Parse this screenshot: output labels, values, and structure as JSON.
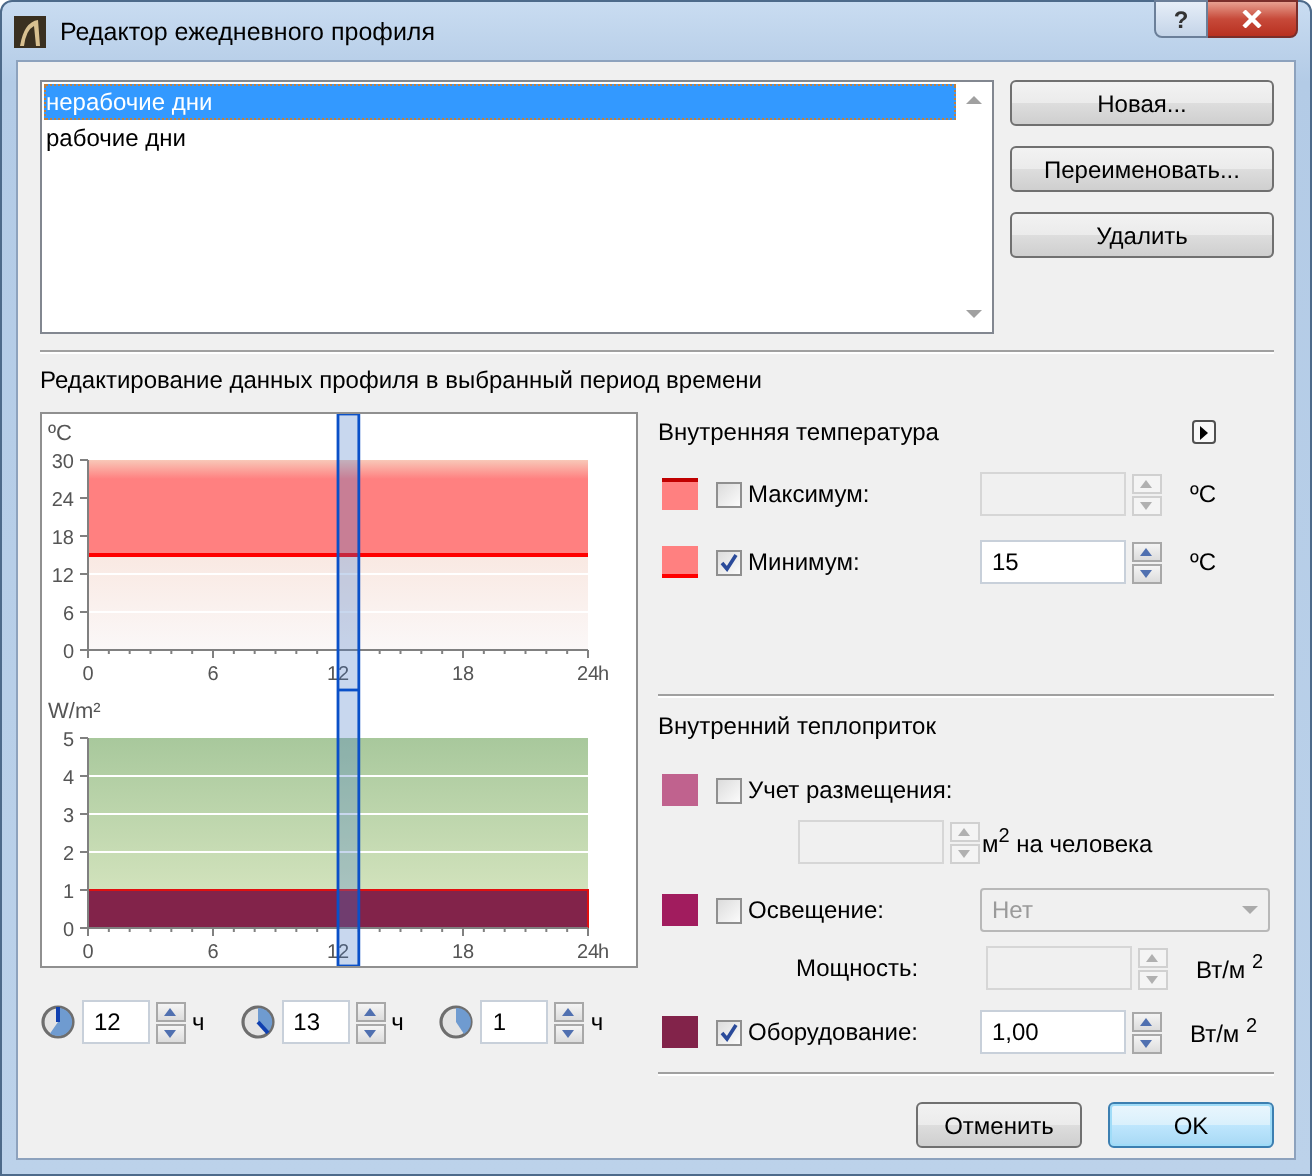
{
  "window": {
    "title": "Редактор ежедневного профиля",
    "help_button": "?"
  },
  "profiles": {
    "items": [
      {
        "label": "нерабочие дни",
        "selected": true
      },
      {
        "label": "рабочие дни",
        "selected": false
      }
    ]
  },
  "profile_buttons": [
    "Новая...",
    "Переименовать...",
    "Удалить"
  ],
  "period_section": {
    "title": "Редактирование данных профиля в выбранный период времени"
  },
  "temperature_chart": {
    "chart_data": {
      "type": "line",
      "ylabel": "ºC",
      "xlabel": "h",
      "x": [
        0,
        24
      ],
      "series": [
        {
          "color": "#ff0000",
          "values": [
            15,
            15
          ]
        }
      ],
      "xlim": [
        0,
        24
      ],
      "ylim": [
        0,
        30
      ],
      "xticks": [
        0,
        6,
        12,
        18,
        24
      ],
      "yticks": [
        0,
        6,
        12,
        18,
        24,
        30
      ],
      "grid": true,
      "bands": [
        {
          "axis": "x",
          "from": 12,
          "to": 13
        }
      ]
    }
  },
  "heat_chart": {
    "chart_data": {
      "type": "area",
      "ylabel": "W/m²",
      "xlabel": "h",
      "x": [
        0,
        24
      ],
      "series": [
        {
          "color": "#82234a",
          "values": [
            1,
            1
          ]
        }
      ],
      "xlim": [
        0,
        24
      ],
      "ylim": [
        0,
        5
      ],
      "xticks": [
        0,
        6,
        12,
        18,
        24
      ],
      "yticks": [
        0,
        1,
        2,
        3,
        4,
        5
      ],
      "grid": true,
      "bands": [
        {
          "axis": "x",
          "from": 12,
          "to": 13
        }
      ]
    }
  },
  "time_fields": [
    {
      "kind": "start",
      "value": "12",
      "unit": "ч"
    },
    {
      "kind": "end",
      "value": "13",
      "unit": "ч"
    },
    {
      "kind": "duration",
      "value": "1",
      "unit": "ч"
    }
  ],
  "temperature": {
    "title": "Внутренняя температура",
    "rows": [
      {
        "kind": "max",
        "label": "Максимум:",
        "checked": false,
        "unit": "ºC"
      },
      {
        "kind": "min",
        "label": "Минимум:",
        "checked": true,
        "value": "15",
        "unit": "ºC"
      }
    ]
  },
  "heat_gain": {
    "title": "Внутренний теплоприток",
    "rows": [
      {
        "kind": "occupancy",
        "label": "Учет размещения:",
        "checked": false,
        "color": "#c0628e",
        "unit": "м$^{2}$ на человека"
      },
      {
        "kind": "lighting",
        "label": "Освещение:",
        "checked": false,
        "color": "#a11c5e",
        "dropdown": "Нет",
        "power_label": "Мощность:",
        "unit": "Вт/м $^{2}$"
      },
      {
        "kind": "equipment",
        "label": "Оборудование:",
        "checked": true,
        "color": "#82234a",
        "value": "1,00",
        "unit": "Вт/м $^{2}$"
      }
    ]
  },
  "dialog_buttons": [
    {
      "label": "Отменить",
      "default": false
    },
    {
      "label": "OK",
      "default": true
    }
  ]
}
